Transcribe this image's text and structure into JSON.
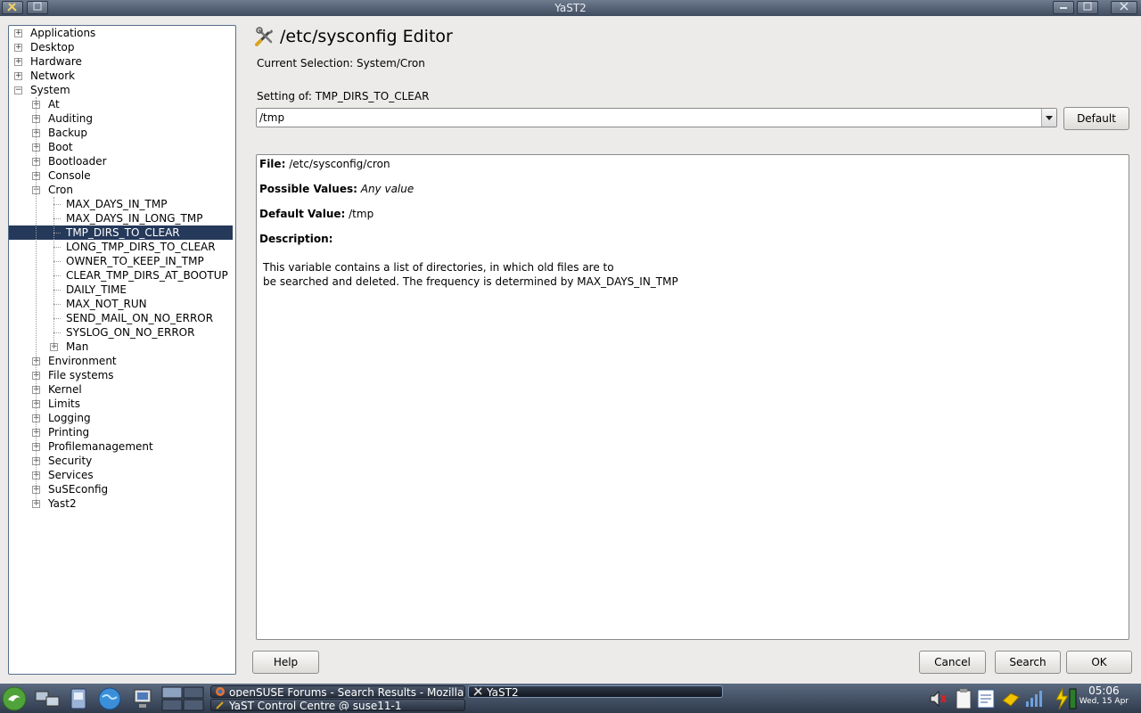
{
  "window": {
    "title": "YaST2"
  },
  "tree": {
    "items": [
      {
        "label": "Applications",
        "level": 0,
        "expander": "plus"
      },
      {
        "label": "Desktop",
        "level": 0,
        "expander": "plus"
      },
      {
        "label": "Hardware",
        "level": 0,
        "expander": "plus"
      },
      {
        "label": "Network",
        "level": 0,
        "expander": "plus"
      },
      {
        "label": "System",
        "level": 0,
        "expander": "minus"
      },
      {
        "label": "At",
        "level": 1,
        "expander": "plus"
      },
      {
        "label": "Auditing",
        "level": 1,
        "expander": "plus"
      },
      {
        "label": "Backup",
        "level": 1,
        "expander": "plus"
      },
      {
        "label": "Boot",
        "level": 1,
        "expander": "plus"
      },
      {
        "label": "Bootloader",
        "level": 1,
        "expander": "plus"
      },
      {
        "label": "Console",
        "level": 1,
        "expander": "plus"
      },
      {
        "label": "Cron",
        "level": 1,
        "expander": "minus"
      },
      {
        "label": "MAX_DAYS_IN_TMP",
        "level": 2,
        "expander": "none"
      },
      {
        "label": "MAX_DAYS_IN_LONG_TMP",
        "level": 2,
        "expander": "none"
      },
      {
        "label": "TMP_DIRS_TO_CLEAR",
        "level": 2,
        "expander": "none",
        "selected": true
      },
      {
        "label": "LONG_TMP_DIRS_TO_CLEAR",
        "level": 2,
        "expander": "none"
      },
      {
        "label": "OWNER_TO_KEEP_IN_TMP",
        "level": 2,
        "expander": "none"
      },
      {
        "label": "CLEAR_TMP_DIRS_AT_BOOTUP",
        "level": 2,
        "expander": "none"
      },
      {
        "label": "DAILY_TIME",
        "level": 2,
        "expander": "none"
      },
      {
        "label": "MAX_NOT_RUN",
        "level": 2,
        "expander": "none"
      },
      {
        "label": "SEND_MAIL_ON_NO_ERROR",
        "level": 2,
        "expander": "none"
      },
      {
        "label": "SYSLOG_ON_NO_ERROR",
        "level": 2,
        "expander": "none"
      },
      {
        "label": "Man",
        "level": 2,
        "expander": "plus"
      },
      {
        "label": "Environment",
        "level": 1,
        "expander": "plus"
      },
      {
        "label": "File systems",
        "level": 1,
        "expander": "plus"
      },
      {
        "label": "Kernel",
        "level": 1,
        "expander": "plus"
      },
      {
        "label": "Limits",
        "level": 1,
        "expander": "plus"
      },
      {
        "label": "Logging",
        "level": 1,
        "expander": "plus"
      },
      {
        "label": "Printing",
        "level": 1,
        "expander": "plus"
      },
      {
        "label": "Profilemanagement",
        "level": 1,
        "expander": "plus"
      },
      {
        "label": "Security",
        "level": 1,
        "expander": "plus"
      },
      {
        "label": "Services",
        "level": 1,
        "expander": "plus"
      },
      {
        "label": "SuSEconfig",
        "level": 1,
        "expander": "plus"
      },
      {
        "label": "Yast2",
        "level": 1,
        "expander": "plus"
      }
    ]
  },
  "main": {
    "heading": "/etc/sysconfig Editor",
    "current_selection": "Current Selection: System/Cron",
    "setting_label": "Setting of: TMP_DIRS_TO_CLEAR",
    "setting_value": "/tmp",
    "default_button": "Default",
    "info": {
      "file_label": "File:",
      "file_value": " /etc/sysconfig/cron",
      "possible_label": "Possible Values:",
      "possible_value": " Any value",
      "default_label": "Default Value:",
      "default_value": " /tmp",
      "description_label": "Description:",
      "description_line1": "This variable contains a list of directories, in which old files are to",
      "description_line2": "be searched and deleted. The frequency is determined by MAX_DAYS_IN_TMP"
    }
  },
  "buttons": {
    "help": "Help",
    "cancel": "Cancel",
    "search": "Search",
    "ok": "OK"
  },
  "taskbar": {
    "tasks": [
      {
        "label": "openSUSE Forums - Search Results - Mozilla",
        "icon": "firefox-icon"
      },
      {
        "label": "YaST Control Centre @ suse11-1",
        "icon": "yast-icon"
      },
      {
        "label": "YaST2",
        "icon": "yast-tools-icon",
        "active": true
      }
    ],
    "clock_time": "05:06",
    "clock_date": "Wed, 15 Apr"
  },
  "colors": {
    "selection": "#25395a",
    "titlebar": "#4f5b6e",
    "taskbar": "#3a4558"
  }
}
